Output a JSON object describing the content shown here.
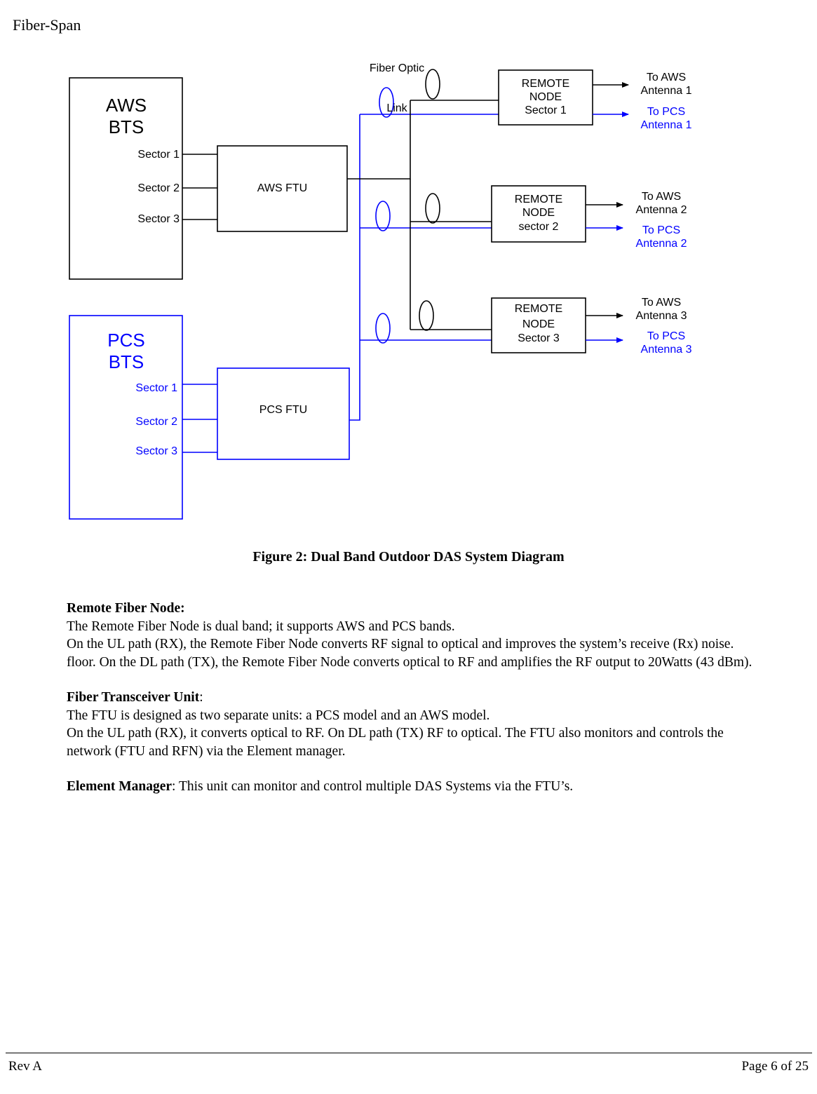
{
  "document": {
    "header_title": "Fiber-Span",
    "figure_caption": "Figure 2: Dual Band Outdoor DAS System Diagram"
  },
  "colors": {
    "aws_black": "#000000",
    "pcs_blue": "#0000ff",
    "page_background": "#ffffff"
  },
  "diagram": {
    "fiber_link_label_line1": "Fiber Optic",
    "fiber_link_label_line2": "Link",
    "aws_bts": {
      "title_line1": "AWS",
      "title_line2": "BTS",
      "sectors": [
        "Sector 1",
        "Sector 2",
        "Sector 3"
      ]
    },
    "pcs_bts": {
      "title_line1": "PCS",
      "title_line2": "BTS",
      "sectors": [
        "Sector 1",
        "Sector 2",
        "Sector 3"
      ]
    },
    "aws_ftu_label": "AWS FTU",
    "pcs_ftu_label": "PCS FTU",
    "remote_nodes": [
      {
        "line1": "REMOTE",
        "line2": "NODE",
        "line3": "Sector 1",
        "aws_out_line1": "To AWS",
        "aws_out_line2": "Antenna 1",
        "pcs_out_line1": "To PCS",
        "pcs_out_line2": "Antenna 1"
      },
      {
        "line1": "REMOTE",
        "line2": "NODE",
        "line3": "sector 2",
        "aws_out_line1": "To AWS",
        "aws_out_line2": "Antenna 2",
        "pcs_out_line1": "To PCS",
        "pcs_out_line2": "Antenna 2"
      },
      {
        "line1": "REMOTE",
        "line2": "NODE",
        "line3": "Sector 3",
        "aws_out_line1": "To AWS",
        "aws_out_line2": "Antenna 3",
        "pcs_out_line1": "To PCS",
        "pcs_out_line2": "Antenna 3"
      }
    ]
  },
  "sections": {
    "remote_fiber_node": {
      "heading": "Remote Fiber Node:",
      "line1": "The Remote Fiber Node is dual band; it supports AWS and PCS bands.",
      "line2": "On the UL path (RX), the Remote Fiber Node converts RF signal to optical and improves the system’s receive (Rx) noise.",
      "line3": "floor. On the DL path (TX), the Remote Fiber Node converts optical to RF and amplifies the RF output to 20Watts (43 dBm)."
    },
    "fiber_transceiver_unit": {
      "heading": "Fiber Transceiver Unit",
      "heading_colon": ":",
      "line1": "The FTU is designed as two separate units:  a PCS model and an AWS model.",
      "line2": "On the UL path (RX), it converts optical to RF.  On DL path (TX) RF to optical. The FTU also monitors and controls the",
      "line3": "network (FTU and RFN) via the Element manager."
    },
    "element_manager": {
      "heading": "Element Manager",
      "body": ": This unit can monitor and control multiple DAS Systems via the FTU’s."
    }
  },
  "footer": {
    "revision": "Rev A",
    "page_number": "Page 6 of 25"
  }
}
